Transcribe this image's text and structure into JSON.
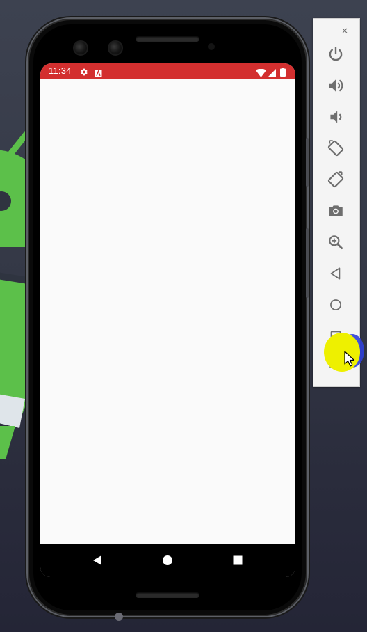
{
  "status_bar": {
    "time": "11:34",
    "color": "#d32f2f",
    "icons": [
      "settings-icon",
      "accessibility-a-icon",
      "wifi-icon",
      "cell-signal-icon",
      "battery-icon"
    ]
  },
  "app": {
    "background": "#fafafa"
  },
  "nav_bar": {
    "buttons": [
      "back-icon",
      "home-icon",
      "recents-icon"
    ]
  },
  "emulator_toolbar": {
    "window_controls": [
      "minimize",
      "close"
    ],
    "minimize_glyph": "–",
    "close_glyph": "×",
    "tools": [
      "power-icon",
      "volume-up-icon",
      "volume-down-icon",
      "rotate-left-icon",
      "rotate-right-icon",
      "camera-icon",
      "zoom-icon",
      "back-icon",
      "home-icon",
      "overview-icon",
      "more-icon"
    ],
    "more_glyph": "•••"
  }
}
